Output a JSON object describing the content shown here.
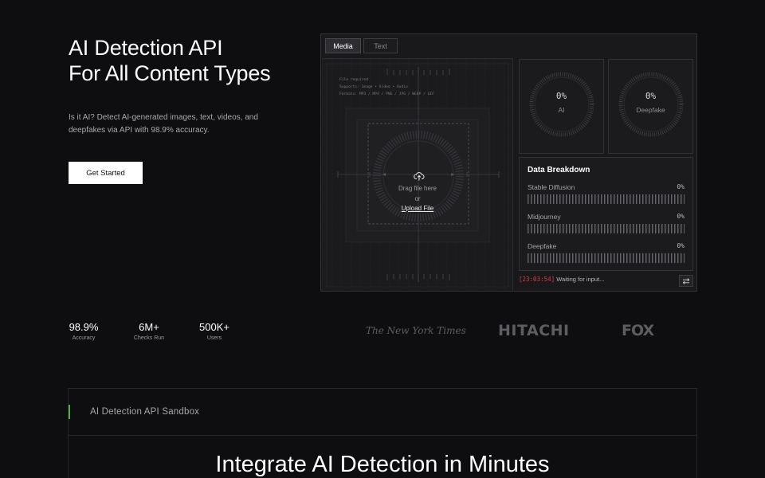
{
  "hero": {
    "title_line1": "AI Detection API",
    "title_line2": "For All Content Types",
    "description": "Is it AI? Detect AI-generated images, text, videos, and deepfakes via API with 98.9% accuracy.",
    "cta_label": "Get Started"
  },
  "widget": {
    "tabs": [
      {
        "label": "Media",
        "active": true
      },
      {
        "label": "Text",
        "active": false
      }
    ],
    "upload": {
      "meta_line1": "File required",
      "meta_line2": "Supports: Image • Video • Audio",
      "meta_line3": "Formats: MP3 / MP4 / PNG / JPG / WEBP / GIF",
      "drag_text": "Drag file here",
      "or_text": "or",
      "link_text": "Upload File",
      "icon": "upload-cloud-icon"
    },
    "gauges": [
      {
        "value": "0%",
        "label": "AI",
        "level": 0
      },
      {
        "value": "0%",
        "label": "Deepfake",
        "level": 0
      }
    ],
    "breakdown": {
      "title": "Data Breakdown",
      "rows": [
        {
          "name": "Stable Diffusion",
          "percent": "0%",
          "level": 0
        },
        {
          "name": "Midjourney",
          "percent": "0%",
          "level": 0
        },
        {
          "name": "Deepfake",
          "percent": "0%",
          "level": 0
        }
      ]
    },
    "status": {
      "time": "[23:03:54]",
      "text": "Waiting for input..."
    },
    "swap_icon": "swap-arrows-icon"
  },
  "stats": [
    {
      "value": "98.9%",
      "label": "Accuracy"
    },
    {
      "value": "6M+",
      "label": "Checks Run"
    },
    {
      "value": "500K+",
      "label": "Users"
    }
  ],
  "logos": {
    "nyt": "The New York Times",
    "hitachi": "HITACHI",
    "fox": "FOX"
  },
  "sandbox": {
    "label": "AI Detection API Sandbox",
    "title": "Integrate AI Detection in Minutes"
  },
  "colors": {
    "background": "#0e0d0f",
    "panel": "#19191b",
    "accent_green": "#4fb243",
    "status_red": "#e0393f"
  }
}
